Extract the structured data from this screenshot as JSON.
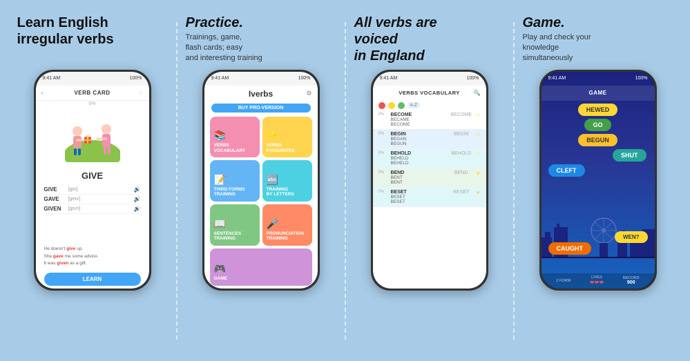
{
  "panels": [
    {
      "id": "panel1",
      "title": "Learn English\nirregular verbs",
      "subtitle": "",
      "phone": {
        "time": "9:41 AM",
        "battery": "100%",
        "header": "VERB CARD",
        "word": "GIVE",
        "progress": "0%",
        "forms": [
          {
            "name": "GIVE",
            "phonetic": "[gɪv]"
          },
          {
            "name": "GAVE",
            "phonetic": "[geɪv]"
          },
          {
            "name": "GIVEN",
            "phonetic": "[gɪvn]"
          }
        ],
        "examples": [
          "He doesn't give up.",
          "She gave me some advice.",
          "It was given as a gift."
        ],
        "learn_btn": "LEARN"
      }
    },
    {
      "id": "panel2",
      "title": "Practice.",
      "subtitle": "Trainings, game,\nflash cards; easy\nand interesting training",
      "phone": {
        "time": "9:41 AM",
        "battery": "100%",
        "app_title": "Iverbs",
        "pro_btn": "BUY PRO-VERSION",
        "menu_items": [
          {
            "label": "VERBS\nVOCABULARY",
            "color": "pink",
            "icon": "📚"
          },
          {
            "label": "VERBS\nFAVOURITES",
            "color": "yellow",
            "icon": "⭐"
          },
          {
            "label": "THIRD FORMS\nTRAINING",
            "color": "blue",
            "icon": "📝"
          },
          {
            "label": "TRAINING\nBY LETTERS",
            "color": "teal",
            "icon": "🔤"
          },
          {
            "label": "SENTENCES\nTRAINING",
            "color": "green",
            "icon": "📖"
          },
          {
            "label": "PRONUNCIATION\nTRAINING",
            "color": "orange",
            "icon": "🎤"
          },
          {
            "label": "GAME",
            "color": "purple",
            "icon": "🎮"
          }
        ]
      }
    },
    {
      "id": "panel3",
      "title": "All verbs are\nvoiced\nin England",
      "subtitle": "",
      "phone": {
        "time": "9:41 AM",
        "battery": "100%",
        "header": "VERBS VOCABULARY",
        "filter": "A-Z",
        "verbs": [
          {
            "bg": "white",
            "progress": "0%",
            "f1": "BECOME",
            "f2": "BECAME",
            "f3": "BECOME",
            "trans": "BECOME",
            "starred": false
          },
          {
            "bg": "blue",
            "progress": "0%",
            "f1": "BEGIN",
            "f2": "BEGAN",
            "f3": "BEGUN",
            "trans": "BEGIN",
            "starred": false
          },
          {
            "bg": "teal",
            "progress": "0%",
            "f1": "BEHOLD",
            "f2": "BEHELD",
            "f3": "BEHELD",
            "trans": "BEHOLD",
            "starred": false
          },
          {
            "bg": "green",
            "progress": "0%",
            "f1": "BEND",
            "f2": "BENT",
            "f3": "BENT",
            "trans": "BEND",
            "starred": true
          },
          {
            "bg": "teal",
            "progress": "0%",
            "f1": "BESET",
            "f2": "BESET",
            "f3": "BESET",
            "trans": "RESET",
            "starred": true
          }
        ]
      }
    },
    {
      "id": "panel4",
      "title": "Game.",
      "subtitle": "Play and check your\nknowledge\nsimultaneously",
      "phone": {
        "time": "9:41 AM",
        "battery": "100%",
        "header": "GAME",
        "word_top": "HEWED",
        "words": [
          {
            "text": "HEWED",
            "style": "yellow"
          },
          {
            "text": "GO",
            "style": "green"
          },
          {
            "text": "BEGUN",
            "style": "yellow2"
          },
          {
            "text": "SHUT",
            "style": "teal"
          },
          {
            "text": "CLEFT",
            "style": "blue"
          },
          {
            "text": "CAUGHT",
            "style": "orange"
          },
          {
            "text": "WEN?",
            "style": "yellow"
          }
        ],
        "footer": {
          "form_label": "2 FORM",
          "lives_label": "LIVES",
          "lives_value": "3",
          "record_label": "RECORD",
          "record_value": "900"
        }
      }
    }
  ],
  "icons": {
    "back_arrow": "‹",
    "star": "☆",
    "star_filled": "★",
    "search": "🔍",
    "gear": "⚙",
    "heart": "❤",
    "sound": "🔊",
    "chevron_left": "❮",
    "chevron_right": "❯"
  }
}
